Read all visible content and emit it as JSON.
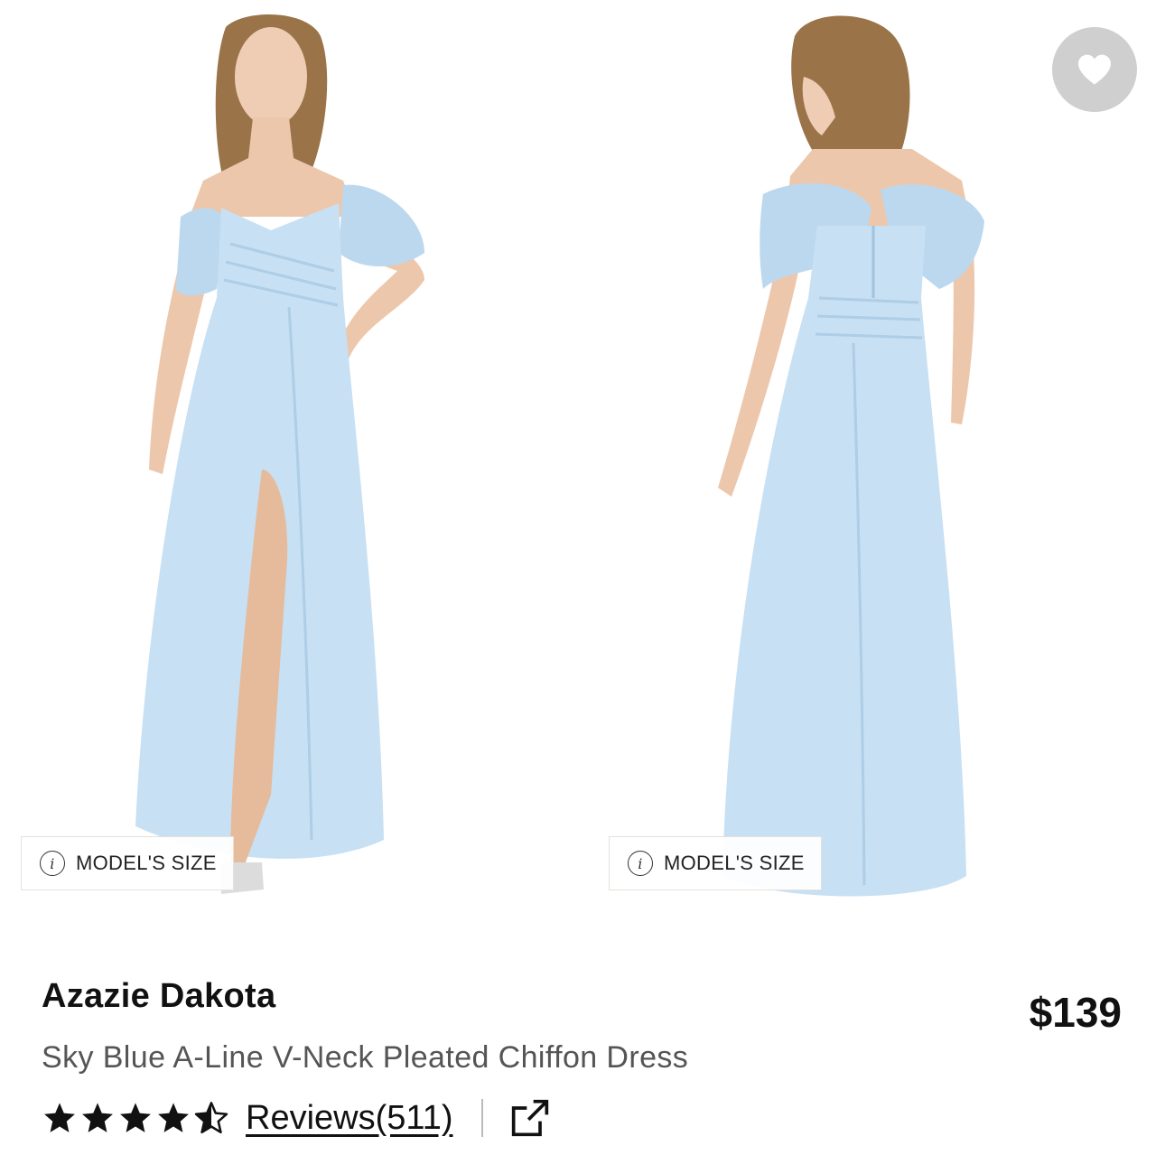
{
  "product": {
    "title": "Azazie Dakota",
    "subtitle": "Sky Blue A-Line V-Neck Pleated Chiffon Dress",
    "price": "$139",
    "rating": 4.5,
    "reviews_label": "Reviews(511)"
  },
  "gallery": {
    "front_badge": "MODEL'S SIZE",
    "back_badge": "MODEL'S SIZE"
  },
  "icons": {
    "favorite": "heart-icon",
    "info": "info-icon",
    "share": "share-external-icon",
    "star": "star-icon"
  },
  "colors": {
    "dress": "#c7e0f3",
    "favorite_bg": "#cfcfcf",
    "text": "#111111",
    "subtitle": "#555555"
  }
}
